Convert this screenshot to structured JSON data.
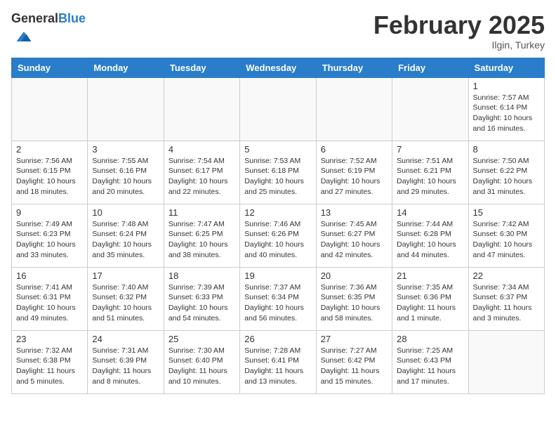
{
  "header": {
    "logo_general": "General",
    "logo_blue": "Blue",
    "month_title": "February 2025",
    "location": "Ilgin, Turkey"
  },
  "days_of_week": [
    "Sunday",
    "Monday",
    "Tuesday",
    "Wednesday",
    "Thursday",
    "Friday",
    "Saturday"
  ],
  "weeks": [
    [
      {
        "day": "",
        "info": ""
      },
      {
        "day": "",
        "info": ""
      },
      {
        "day": "",
        "info": ""
      },
      {
        "day": "",
        "info": ""
      },
      {
        "day": "",
        "info": ""
      },
      {
        "day": "",
        "info": ""
      },
      {
        "day": "1",
        "info": "Sunrise: 7:57 AM\nSunset: 6:14 PM\nDaylight: 10 hours\nand 16 minutes."
      }
    ],
    [
      {
        "day": "2",
        "info": "Sunrise: 7:56 AM\nSunset: 6:15 PM\nDaylight: 10 hours\nand 18 minutes."
      },
      {
        "day": "3",
        "info": "Sunrise: 7:55 AM\nSunset: 6:16 PM\nDaylight: 10 hours\nand 20 minutes."
      },
      {
        "day": "4",
        "info": "Sunrise: 7:54 AM\nSunset: 6:17 PM\nDaylight: 10 hours\nand 22 minutes."
      },
      {
        "day": "5",
        "info": "Sunrise: 7:53 AM\nSunset: 6:18 PM\nDaylight: 10 hours\nand 25 minutes."
      },
      {
        "day": "6",
        "info": "Sunrise: 7:52 AM\nSunset: 6:19 PM\nDaylight: 10 hours\nand 27 minutes."
      },
      {
        "day": "7",
        "info": "Sunrise: 7:51 AM\nSunset: 6:21 PM\nDaylight: 10 hours\nand 29 minutes."
      },
      {
        "day": "8",
        "info": "Sunrise: 7:50 AM\nSunset: 6:22 PM\nDaylight: 10 hours\nand 31 minutes."
      }
    ],
    [
      {
        "day": "9",
        "info": "Sunrise: 7:49 AM\nSunset: 6:23 PM\nDaylight: 10 hours\nand 33 minutes."
      },
      {
        "day": "10",
        "info": "Sunrise: 7:48 AM\nSunset: 6:24 PM\nDaylight: 10 hours\nand 35 minutes."
      },
      {
        "day": "11",
        "info": "Sunrise: 7:47 AM\nSunset: 6:25 PM\nDaylight: 10 hours\nand 38 minutes."
      },
      {
        "day": "12",
        "info": "Sunrise: 7:46 AM\nSunset: 6:26 PM\nDaylight: 10 hours\nand 40 minutes."
      },
      {
        "day": "13",
        "info": "Sunrise: 7:45 AM\nSunset: 6:27 PM\nDaylight: 10 hours\nand 42 minutes."
      },
      {
        "day": "14",
        "info": "Sunrise: 7:44 AM\nSunset: 6:28 PM\nDaylight: 10 hours\nand 44 minutes."
      },
      {
        "day": "15",
        "info": "Sunrise: 7:42 AM\nSunset: 6:30 PM\nDaylight: 10 hours\nand 47 minutes."
      }
    ],
    [
      {
        "day": "16",
        "info": "Sunrise: 7:41 AM\nSunset: 6:31 PM\nDaylight: 10 hours\nand 49 minutes."
      },
      {
        "day": "17",
        "info": "Sunrise: 7:40 AM\nSunset: 6:32 PM\nDaylight: 10 hours\nand 51 minutes."
      },
      {
        "day": "18",
        "info": "Sunrise: 7:39 AM\nSunset: 6:33 PM\nDaylight: 10 hours\nand 54 minutes."
      },
      {
        "day": "19",
        "info": "Sunrise: 7:37 AM\nSunset: 6:34 PM\nDaylight: 10 hours\nand 56 minutes."
      },
      {
        "day": "20",
        "info": "Sunrise: 7:36 AM\nSunset: 6:35 PM\nDaylight: 10 hours\nand 58 minutes."
      },
      {
        "day": "21",
        "info": "Sunrise: 7:35 AM\nSunset: 6:36 PM\nDaylight: 11 hours\nand 1 minute."
      },
      {
        "day": "22",
        "info": "Sunrise: 7:34 AM\nSunset: 6:37 PM\nDaylight: 11 hours\nand 3 minutes."
      }
    ],
    [
      {
        "day": "23",
        "info": "Sunrise: 7:32 AM\nSunset: 6:38 PM\nDaylight: 11 hours\nand 5 minutes."
      },
      {
        "day": "24",
        "info": "Sunrise: 7:31 AM\nSunset: 6:39 PM\nDaylight: 11 hours\nand 8 minutes."
      },
      {
        "day": "25",
        "info": "Sunrise: 7:30 AM\nSunset: 6:40 PM\nDaylight: 11 hours\nand 10 minutes."
      },
      {
        "day": "26",
        "info": "Sunrise: 7:28 AM\nSunset: 6:41 PM\nDaylight: 11 hours\nand 13 minutes."
      },
      {
        "day": "27",
        "info": "Sunrise: 7:27 AM\nSunset: 6:42 PM\nDaylight: 11 hours\nand 15 minutes."
      },
      {
        "day": "28",
        "info": "Sunrise: 7:25 AM\nSunset: 6:43 PM\nDaylight: 11 hours\nand 17 minutes."
      },
      {
        "day": "",
        "info": ""
      }
    ]
  ]
}
